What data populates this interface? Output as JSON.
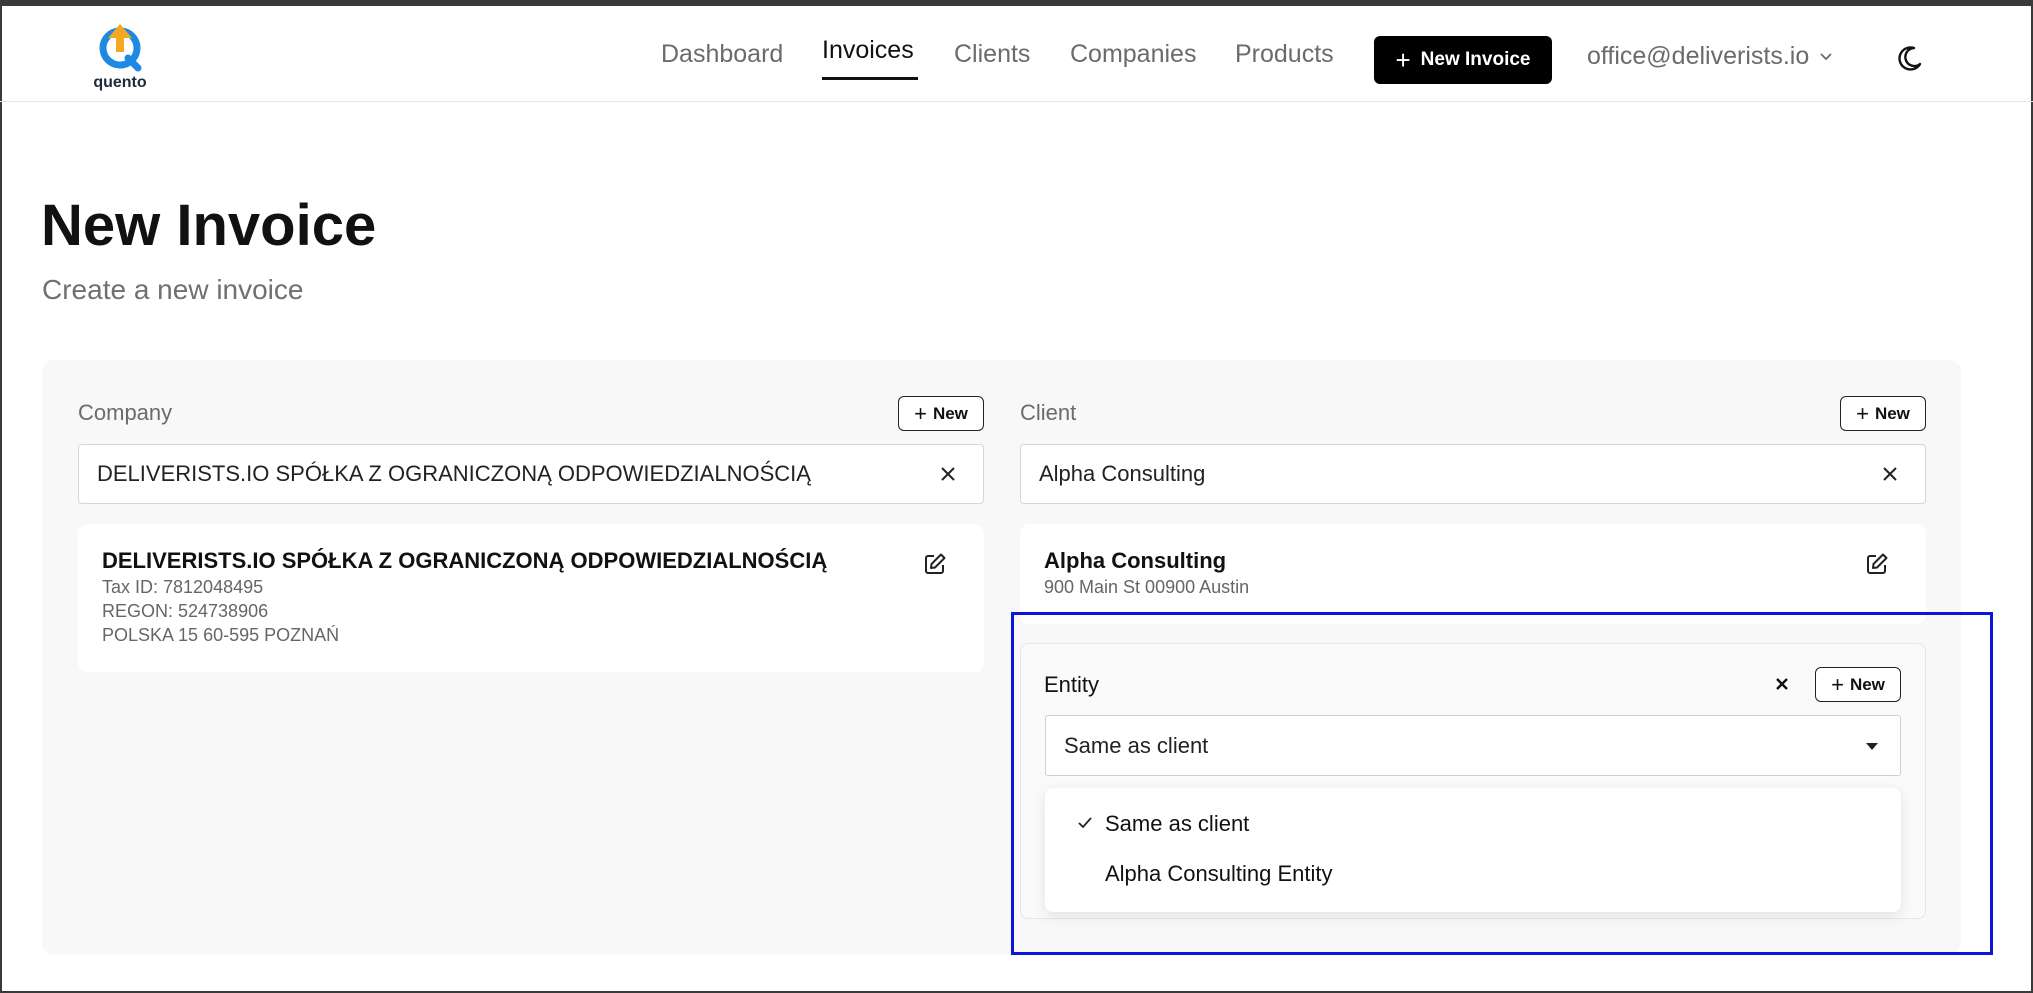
{
  "app": {
    "logo_text": "quento"
  },
  "nav": {
    "items": [
      {
        "label": "Dashboard",
        "active": false
      },
      {
        "label": "Invoices",
        "active": true
      },
      {
        "label": "Clients",
        "active": false
      },
      {
        "label": "Companies",
        "active": false
      },
      {
        "label": "Products",
        "active": false
      }
    ],
    "new_invoice_label": "New Invoice",
    "account_email": "office@deliverists.io"
  },
  "page": {
    "title": "New Invoice",
    "subtitle": "Create a new invoice"
  },
  "company": {
    "label": "Company",
    "new_label": "New",
    "selected": "DELIVERISTS.IO SPÓŁKA Z OGRANICZONĄ ODPOWIEDZIALNOŚCIĄ",
    "card": {
      "name": "DELIVERISTS.IO SPÓŁKA Z OGRANICZONĄ ODPOWIEDZIALNOŚCIĄ",
      "tax_id": "Tax ID: 7812048495",
      "regon": "REGON: 524738906",
      "address": "POLSKA 15 60-595 POZNAŃ"
    }
  },
  "client": {
    "label": "Client",
    "new_label": "New",
    "selected": "Alpha Consulting",
    "card": {
      "name": "Alpha Consulting",
      "address": "900 Main St 00900 Austin"
    }
  },
  "entity": {
    "label": "Entity",
    "new_label": "New",
    "selected": "Same as client",
    "options": [
      {
        "label": "Same as client",
        "checked": true
      },
      {
        "label": "Alpha Consulting Entity",
        "checked": false
      }
    ]
  },
  "colors": {
    "accent": "#000000",
    "highlight": "#0b16d9"
  },
  "icons": [
    "logo-icon",
    "plus-icon",
    "chevron-down-icon",
    "moon-icon",
    "close-icon",
    "edit-icon",
    "check-icon",
    "caret-down-icon"
  ]
}
